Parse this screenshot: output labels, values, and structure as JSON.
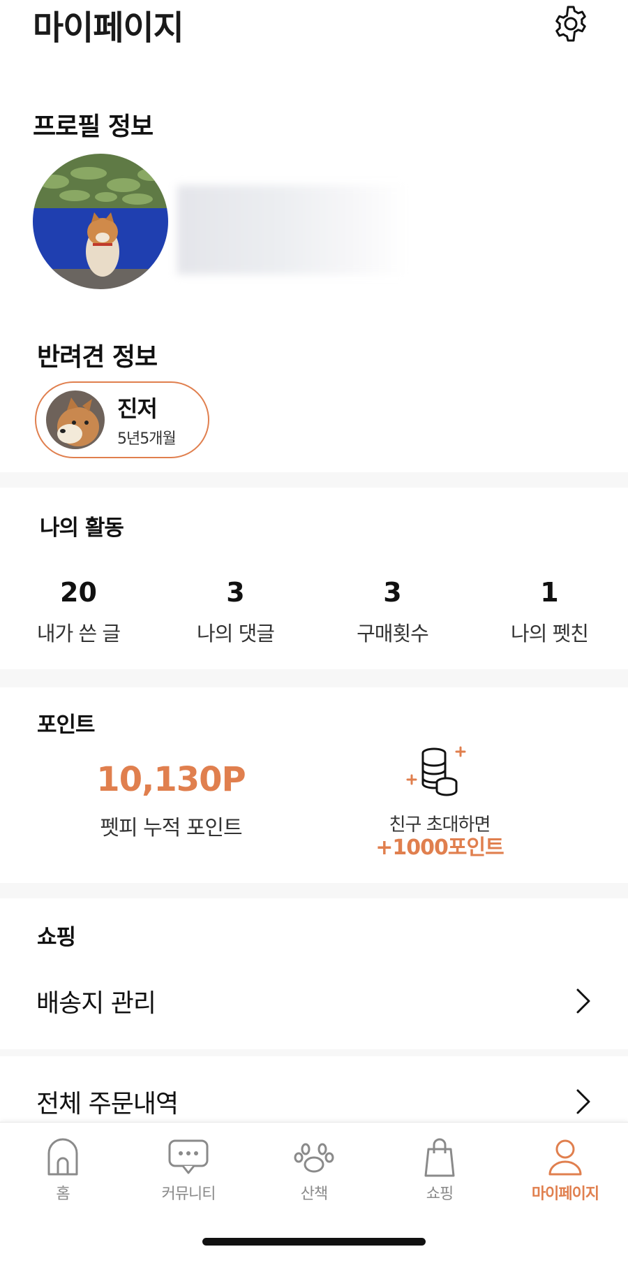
{
  "header": {
    "title": "마이페이지",
    "settings_icon": "gear-icon"
  },
  "profile": {
    "section_title": "프로필 정보"
  },
  "pet": {
    "section_title": "반려견 정보",
    "name": "진저",
    "age": "5년5개월"
  },
  "activity": {
    "section_title": "나의 활동",
    "stats": [
      {
        "value": "20",
        "label": "내가 쓴 글"
      },
      {
        "value": "3",
        "label": "나의 댓글"
      },
      {
        "value": "3",
        "label": "구매횟수"
      },
      {
        "value": "1",
        "label": "나의 펫친"
      }
    ]
  },
  "points": {
    "section_title": "포인트",
    "value": "10,130P",
    "label": "펫피 누적 포인트",
    "invite_text": "친구 초대하면",
    "invite_bonus": "+1000포인트"
  },
  "shopping": {
    "section_title": "쇼핑",
    "items": [
      {
        "label": "배송지 관리"
      },
      {
        "label": "전체 주문내역"
      }
    ]
  },
  "tabbar": {
    "tabs": [
      {
        "label": "홈",
        "icon": "home-icon"
      },
      {
        "label": "커뮤니티",
        "icon": "chat-bubble-icon"
      },
      {
        "label": "산책",
        "icon": "paw-icon"
      },
      {
        "label": "쇼핑",
        "icon": "shopping-bag-icon"
      },
      {
        "label": "마이페이지",
        "icon": "person-icon"
      }
    ],
    "active_index": 4
  },
  "colors": {
    "accent": "#e07f4e",
    "text": "#111111",
    "muted": "#8a8a8a"
  }
}
